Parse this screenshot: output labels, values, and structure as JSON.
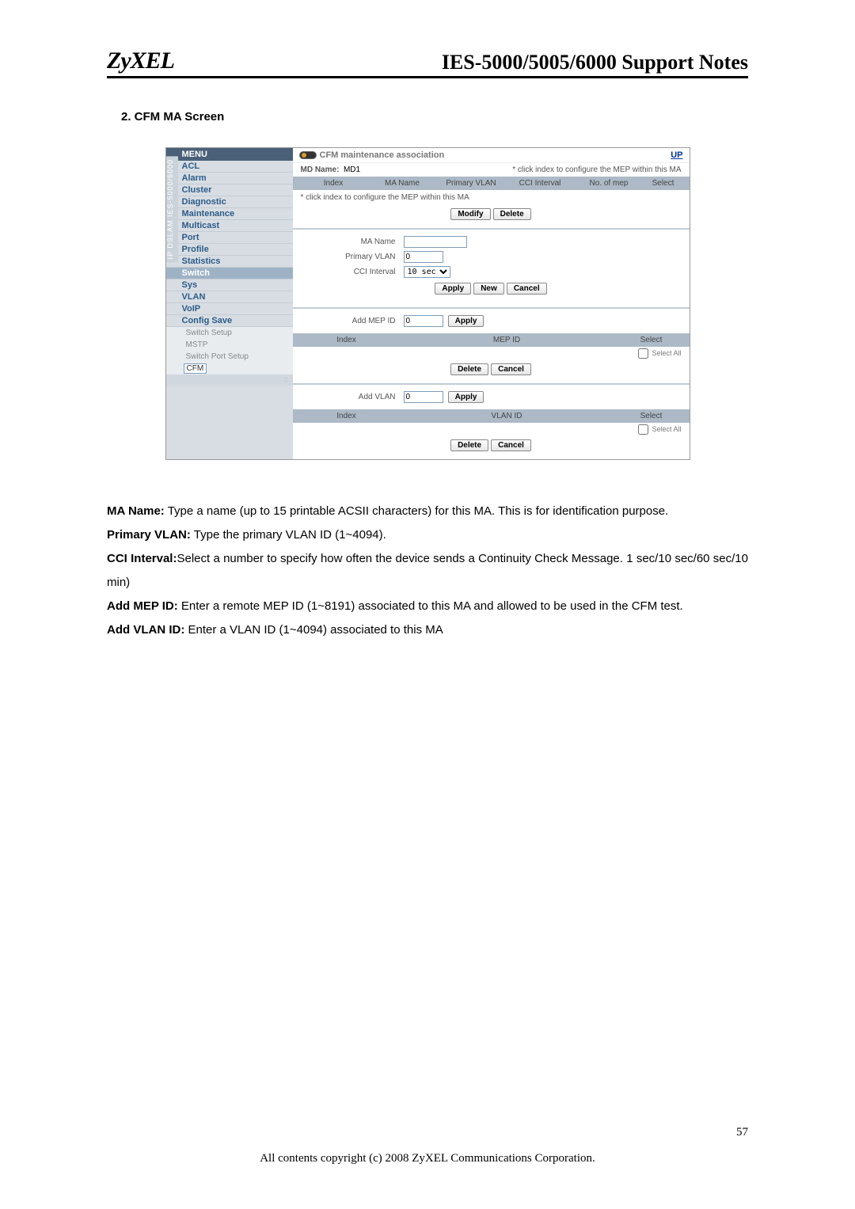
{
  "header": {
    "logo": "ZyXEL",
    "title": "IES-5000/5005/6000 Support Notes"
  },
  "section_title": "2.  CFM MA Screen",
  "shot": {
    "sidebar": {
      "vtab": "IP DSLAM IES-5000/6000",
      "menu_head": "MENU",
      "items": [
        "ACL",
        "Alarm",
        "Cluster",
        "Diagnostic",
        "Maintenance",
        "Multicast",
        "Port",
        "Profile",
        "Statistics",
        "Switch",
        "Sys",
        "VLAN",
        "VoIP",
        "Config Save"
      ],
      "selected": "Switch",
      "subitems": [
        "Switch Setup",
        "MSTP",
        "Switch Port Setup",
        "CFM"
      ],
      "sub_selected": "CFM"
    },
    "panel": {
      "title": "CFM maintenance association",
      "up": "UP",
      "md_label": "MD Name:",
      "md_value": "MD1",
      "hint": "* click index to configure the MEP within this MA",
      "table1_heads": [
        "Index",
        "MA Name",
        "Primary VLAN",
        "CCI Interval",
        "No. of mep",
        "Select"
      ],
      "note": "* click index to configure the MEP within this MA",
      "btn_modify": "Modify",
      "btn_delete": "Delete",
      "f_ma_name": "MA Name",
      "f_pvlan": "Primary VLAN",
      "f_pvlan_val": "0",
      "f_cci": "CCI Interval",
      "f_cci_val": "10 sec",
      "btn_apply": "Apply",
      "btn_new": "New",
      "btn_cancel": "Cancel",
      "f_add_mep": "Add MEP ID",
      "f_add_mep_val": "0",
      "t2_heads": [
        "Index",
        "MEP ID",
        "Select"
      ],
      "select_all": "Select All",
      "f_add_vlan": "Add VLAN",
      "f_add_vlan_val": "0",
      "t3_heads": [
        "Index",
        "VLAN ID",
        "Select"
      ]
    }
  },
  "desc": {
    "p1a": "MA Name:",
    "p1b": " Type a name (up to 15 printable ACSII characters) for this MA. This is for identification purpose.",
    "p2a": "Primary VLAN:",
    "p2b": " Type the primary VLAN ID (1~4094).",
    "p3a": "CCI Interval:",
    "p3b": "Select a number to specify how often the device sends a Continuity Check Message. 1 sec/10 sec/60 sec/10 min)",
    "p4a": "Add MEP ID:",
    "p4b": " Enter a remote MEP ID (1~8191) associated to this MA and allowed to be used in the CFM test.",
    "p5a": "Add VLAN ID:",
    "p5b": " Enter a VLAN ID (1~4094) associated to this MA"
  },
  "page_number": "57",
  "copyright": "All contents copyright (c) 2008 ZyXEL Communications Corporation."
}
